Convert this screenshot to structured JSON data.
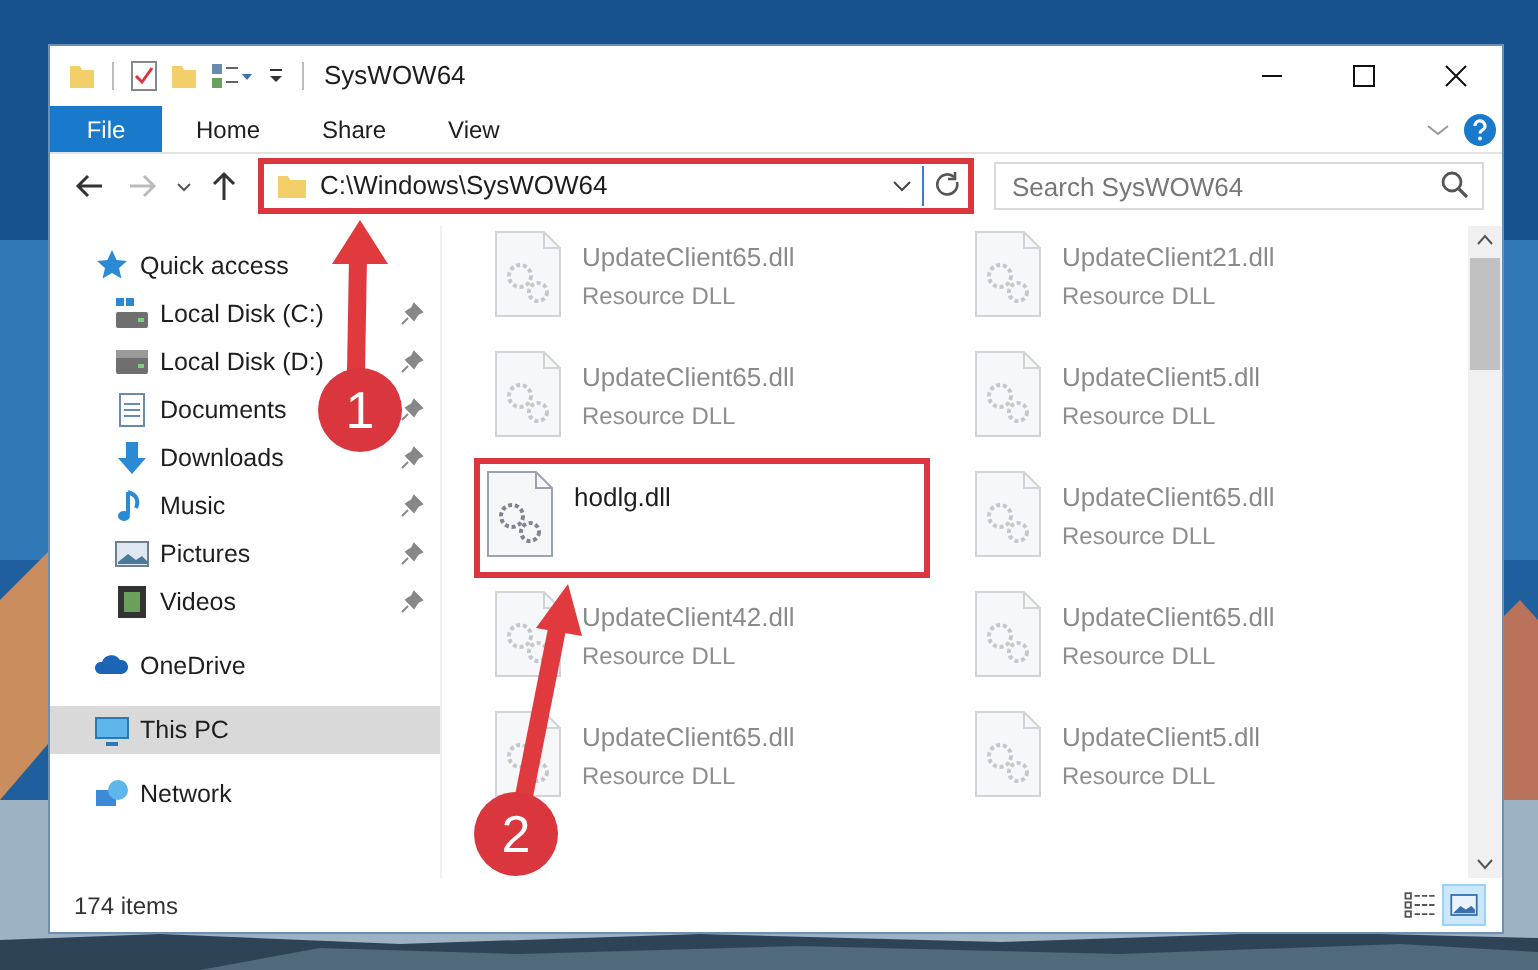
{
  "window": {
    "title": "SysWOW64"
  },
  "ribbon": {
    "file_tab": {
      "label": "File"
    },
    "tabs": [
      {
        "label": "Home"
      },
      {
        "label": "Share"
      },
      {
        "label": "View"
      }
    ]
  },
  "address_bar": {
    "path": "C:\\Windows\\SysWOW64",
    "highlighted": true
  },
  "search": {
    "placeholder": "Search SysWOW64"
  },
  "sidebar": {
    "items": [
      {
        "label": "Quick access",
        "kind": "star",
        "selected": false,
        "children": [
          {
            "label": "Local Disk (C:)",
            "kind": "system-drive",
            "pinned": true,
            "selected": false
          },
          {
            "label": "Local Disk (D:)",
            "kind": "drive",
            "pinned": true,
            "selected": false
          },
          {
            "label": "Documents",
            "kind": "documents",
            "pinned": true,
            "selected": false
          },
          {
            "label": "Downloads",
            "kind": "downloads",
            "pinned": true,
            "selected": false
          },
          {
            "label": "Music",
            "kind": "music",
            "pinned": true,
            "selected": false
          },
          {
            "label": "Pictures",
            "kind": "pictures",
            "pinned": true,
            "selected": false
          },
          {
            "label": "Videos",
            "kind": "videos",
            "pinned": true,
            "selected": false
          }
        ]
      },
      {
        "label": "OneDrive",
        "kind": "cloud",
        "selected": false
      },
      {
        "label": "This PC",
        "kind": "pc",
        "selected": true
      },
      {
        "label": "Network",
        "kind": "network",
        "selected": false
      }
    ]
  },
  "files": [
    {
      "name": "UpdateClient65.dll",
      "type": "Resource DLL",
      "blurred": true,
      "highlighted": false
    },
    {
      "name": "UpdateClient21.dll",
      "type": "Resource DLL",
      "blurred": true,
      "highlighted": false
    },
    {
      "name": "UpdateClient65.dll",
      "type": "Resource DLL",
      "blurred": true,
      "highlighted": false
    },
    {
      "name": "UpdateClient5.dll",
      "type": "Resource DLL",
      "blurred": true,
      "highlighted": false
    },
    {
      "name": "hodlg.dll",
      "blurred": false,
      "highlighted": true
    },
    {
      "name": "UpdateClient65.dll",
      "type": "Resource DLL",
      "blurred": true,
      "highlighted": false
    },
    {
      "name": "UpdateClient42.dll",
      "type": "Resource DLL",
      "blurred": true,
      "highlighted": false
    },
    {
      "name": "UpdateClient65.dll",
      "type": "Resource DLL",
      "blurred": true,
      "highlighted": false
    },
    {
      "name": "UpdateClient65.dll",
      "type": "Resource DLL",
      "blurred": true,
      "highlighted": false
    },
    {
      "name": "UpdateClient5.dll",
      "type": "Resource DLL",
      "blurred": true,
      "highlighted": false
    }
  ],
  "status_bar": {
    "item_count": "174 items",
    "views": [
      {
        "kind": "details",
        "selected": false
      },
      {
        "kind": "large-icons",
        "selected": true
      }
    ]
  },
  "callouts": [
    {
      "number": "1"
    },
    {
      "number": "2"
    }
  ]
}
